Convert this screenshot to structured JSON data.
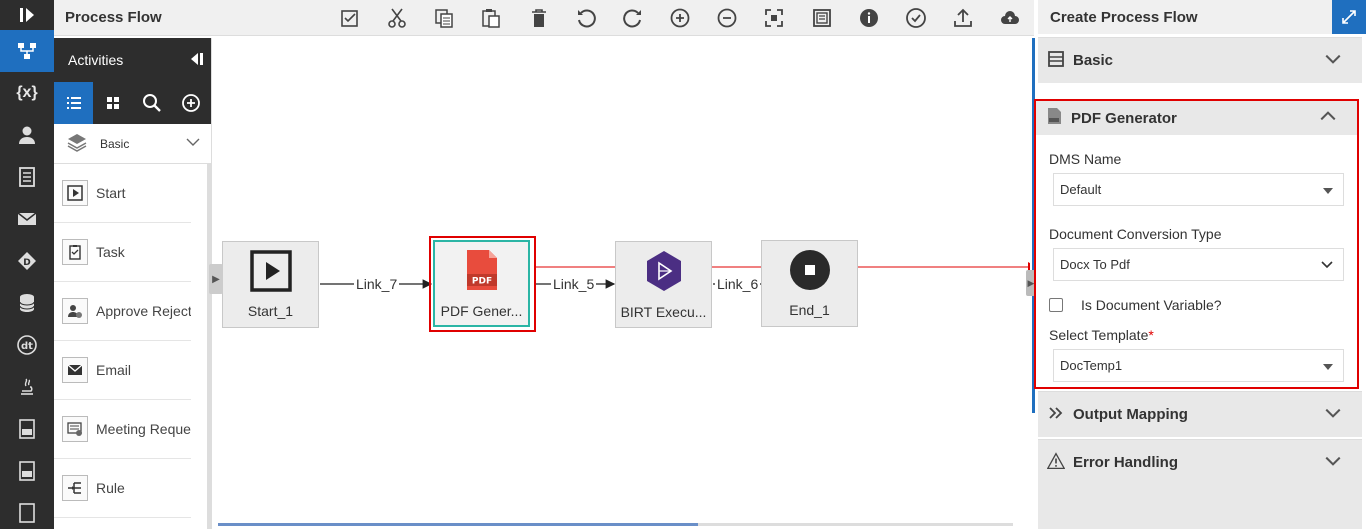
{
  "app": {
    "title": "Process Flow"
  },
  "activities": {
    "title": "Activities",
    "category": "Basic",
    "items": [
      {
        "label": "Start",
        "icon": "start-icon"
      },
      {
        "label": "Task",
        "icon": "task-icon"
      },
      {
        "label": "Approve Reject",
        "icon": "approve-reject-icon"
      },
      {
        "label": "Email",
        "icon": "email-icon"
      },
      {
        "label": "Meeting Request",
        "icon": "meeting-request-icon"
      },
      {
        "label": "Rule",
        "icon": "rule-icon"
      }
    ]
  },
  "canvas": {
    "nodes": [
      {
        "label": "Start_1",
        "icon": "start-node-icon"
      },
      {
        "label": "PDF Gener...",
        "icon": "pdf-icon",
        "badge": "PDF"
      },
      {
        "label": "BIRT Execu...",
        "icon": "birt-icon"
      },
      {
        "label": "End_1",
        "icon": "end-node-icon"
      }
    ],
    "links": [
      "Link_7",
      "Link_5",
      "Link_6"
    ]
  },
  "props": {
    "title": "Create Process Flow",
    "basic": {
      "label": "Basic"
    },
    "pdf": {
      "label": "PDF Generator",
      "dms_label": "DMS Name",
      "dms_value": "Default",
      "conv_label": "Document Conversion Type",
      "conv_value": "Docx To Pdf",
      "is_variable_label": "Is Document Variable?",
      "template_label": "Select Template",
      "template_required": "*",
      "template_value": "DocTemp1"
    },
    "output": {
      "label": "Output Mapping"
    },
    "error": {
      "label": "Error Handling"
    }
  },
  "colors": {
    "accent": "#1f6fbf",
    "highlight": "#e00000",
    "selected": "#2bb5a5",
    "pdf": "#e84c3d",
    "birt": "#4b2e83"
  }
}
